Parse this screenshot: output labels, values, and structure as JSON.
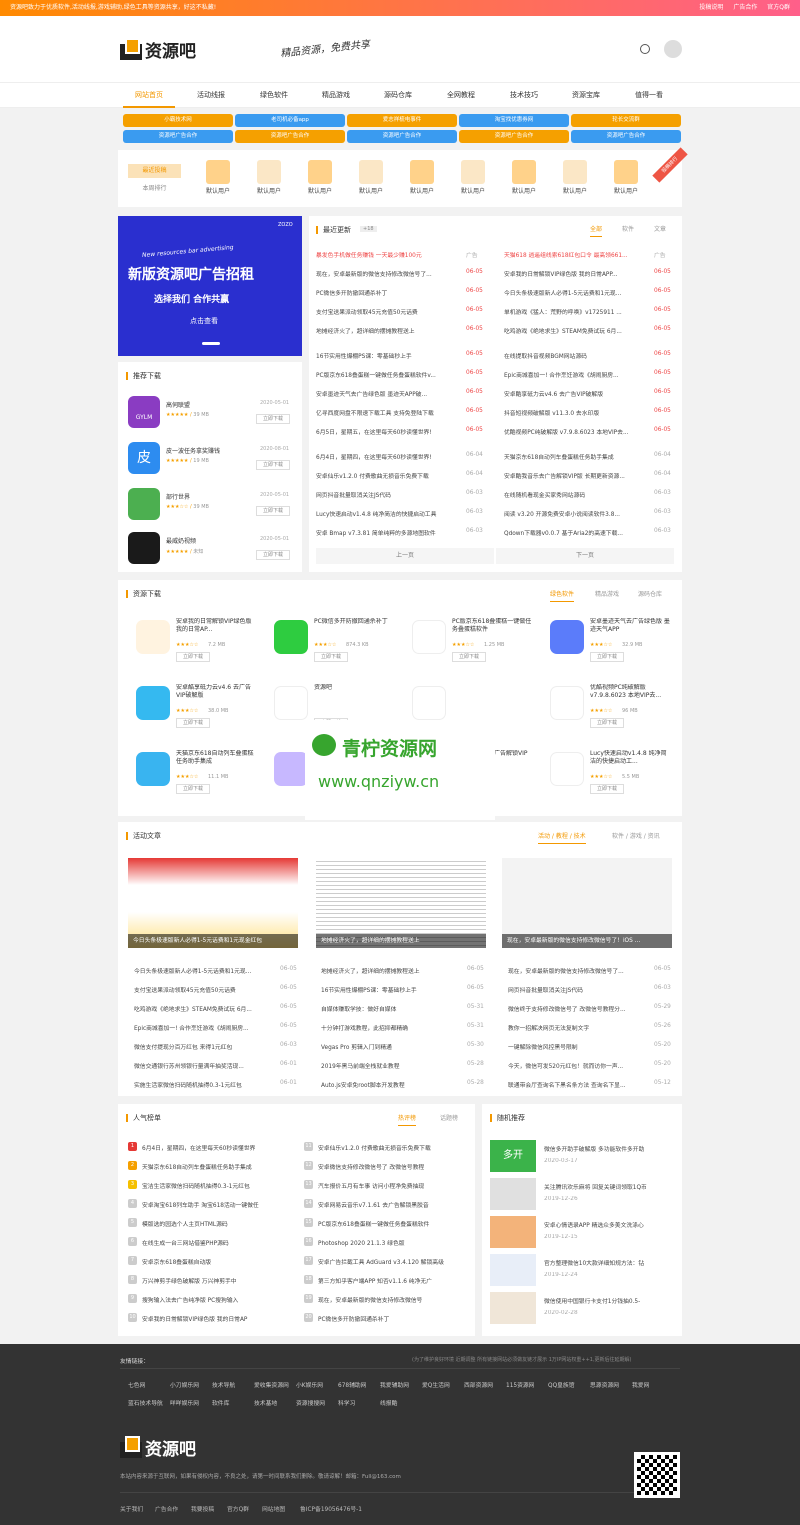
{
  "topbar": {
    "left": "资源吧致力于优质软件,活动线报,游戏辅助,绿色工具等资源共享，好这不私藏!",
    "links": [
      "投稿说明",
      "广告合作",
      "官方Q群"
    ]
  },
  "header": {
    "logo": "资源吧",
    "slogan": "精品资源，免费共享"
  },
  "nav": [
    "网站首页",
    "活动线报",
    "绿色软件",
    "精品游戏",
    "源码仓库",
    "全网教程",
    "技术技巧",
    "资源宝库",
    "值得一看"
  ],
  "tags": [
    "小霸技术网",
    "老司机必备app",
    "爱志祥梳电事件",
    "淘宝找优惠券网",
    "轮长交流群",
    "资源吧广告合作",
    "资源吧广告合作",
    "资源吧广告合作",
    "资源吧广告合作",
    "资源吧广告合作"
  ],
  "users": {
    "tabs": [
      "最近投稿",
      "本周排行"
    ],
    "name": "默认用户",
    "badge": "投稿排行"
  },
  "banner": {
    "eyebrow": "New resources bar advertising",
    "title": "新版资源吧广告招租",
    "subtitle": "选择我们 合作共赢",
    "button": "点击查看",
    "corner": "ZOZO"
  },
  "recommend": {
    "title": "推荐下载",
    "items": [
      {
        "name": "高伺联盟",
        "date": "2020-05-01",
        "size": "39 MB",
        "btn": "立即下载",
        "label": "GYLM"
      },
      {
        "name": "皮一波任务拿奖赚钱",
        "date": "2020-08-01",
        "size": "19 MB",
        "btn": "立即下载",
        "label": "皮"
      },
      {
        "name": "部行世界",
        "date": "2020-05-01",
        "size": "39 MB",
        "btn": "立即下载",
        "label": ""
      },
      {
        "name": "最威奶视频",
        "date": "2020-05-01",
        "size": "未知",
        "btn": "立即下载",
        "label": ""
      }
    ]
  },
  "latest": {
    "title": "最近更新",
    "count": "+18",
    "tabs": [
      "全部",
      "软件",
      "文章"
    ],
    "ad_label": "广告",
    "left": [
      {
        "t": "暴发色手机做任务赚钱 一天最少赚100元",
        "d": "广告",
        "red": true
      },
      {
        "t": "现在，安卓最新版的微信支持修改微信号了...",
        "d": "06-05"
      },
      {
        "t": "PC微信多开防撤回通杀补丁",
        "d": "06-05"
      },
      {
        "t": "支付宝送果派动领取45元充值50元话费",
        "d": "06-05"
      },
      {
        "t": "地摊经济火了，超详细的摆摊教程送上",
        "d": "06-05"
      },
      {
        "t": "16节实用性爆棚PS课：零基础秒上手",
        "d": "06-05"
      },
      {
        "t": "PC版京东618叠蛋糕一键做任务叠蛋糕软件v...",
        "d": "06-05"
      },
      {
        "t": "安卓墨迹天气去广告绿色版 墨迹天APP破...",
        "d": "06-05"
      },
      {
        "t": "亿寻西度网盘不限速下载工具 支持免登陆下载",
        "d": "06-05"
      },
      {
        "t": "6月5日，星期五，在这里每天60秒读懂世界!",
        "d": "06-05"
      },
      {
        "t": "6月4日，星期四，在这里每天60秒读懂世界!",
        "d": "06-04"
      },
      {
        "t": "安卓仙乐v1.2.0 付费歌曲无损音乐免费下载",
        "d": "06-04"
      },
      {
        "t": "网页抖音批量取消关注JS代码",
        "d": "06-03"
      },
      {
        "t": "Lucy快速启动v1.4.8 纯净简洁的快捷启动工具",
        "d": "06-03"
      },
      {
        "t": "安卓 Bmap v7.3.81 简单纯粹的多源地图软件",
        "d": "06-03"
      }
    ],
    "right": [
      {
        "t": "天猫618 逍遥组线索618红包口令 最高领661...",
        "d": "广告",
        "red": true
      },
      {
        "t": "安卓我的日常解锁VIP绿色版 我的日常APP...",
        "d": "06-05"
      },
      {
        "t": "今日头条极速版新人必得1-5元话费和1元现...",
        "d": "06-05"
      },
      {
        "t": "单机游戏《猛人：荒野的呼唤》v1725911 ...",
        "d": "06-05"
      },
      {
        "t": "吃鸡游戏《绝地求生》STEAM免费试玩 6月...",
        "d": "06-05"
      },
      {
        "t": "在线提取抖音视频BGM网站源码",
        "d": "06-05"
      },
      {
        "t": "Epic商城喜加一! 合作烹饪游戏《胡闹厨房...",
        "d": "06-05"
      },
      {
        "t": "安卓酷享砥力云v4.6 去广告VIP破解版",
        "d": "06-05"
      },
      {
        "t": "抖音短视频破解版 v11.3.0 去水印版",
        "d": "06-05"
      },
      {
        "t": "优酷视频PC纯破解版 v7.9.8.6023 本地VIP去...",
        "d": "06-05"
      },
      {
        "t": "天猫京东618自动列车叠蛋糕任务助手集成",
        "d": "06-04"
      },
      {
        "t": "安卓酷我音乐去广告解锁VIP版 长期更新资源...",
        "d": "06-04"
      },
      {
        "t": "在线随机看现金买家秀网站源码",
        "d": "06-03"
      },
      {
        "t": "阅读 v3.20 开源免费安卓小说阅读软件3.8...",
        "d": "06-03"
      },
      {
        "t": "Qdown下载器v0.0.7 基于Aria2的高速下载...",
        "d": "06-03"
      }
    ],
    "prev": "上一页",
    "next": "下一页"
  },
  "resources": {
    "title": "资源下载",
    "tabs": [
      "绿色软件",
      "精品游戏",
      "源码仓库"
    ],
    "items": [
      {
        "name": "安卓我的日常解锁VIP绿色版 我的日常AP...",
        "size": "7.2 MB",
        "btn": "立即下载"
      },
      {
        "name": "PC微信多开防撤回通杀补丁",
        "size": "874.3 KB",
        "btn": "立即下载"
      },
      {
        "name": "PC版京东618叠蛋糕一键做任务叠蛋糕软件",
        "size": "1.25 MB",
        "btn": "立即下载"
      },
      {
        "name": "安卓墨迹天气去广告绿色版 墨迹天气APP",
        "size": "32.9 MB",
        "btn": "立即下载"
      },
      {
        "name": "安卓酷享砥力云v4.6 去广告VIP破解版",
        "size": "38.0 MB",
        "btn": "立即下载"
      },
      {
        "name": "资源吧",
        "size": "",
        "btn": "立即下载"
      },
      {
        "name": "",
        "size": "",
        "btn": ""
      },
      {
        "name": "优酷视频PC纯破解版 v7.9.8.6023 本地VIP去...",
        "size": "96 MB",
        "btn": "立即下载"
      },
      {
        "name": "天猫京东618自动列车叠蛋糕任务助手集成",
        "size": "11.1 MB",
        "btn": "立即下载"
      },
      {
        "name": "",
        "size": "",
        "btn": ""
      },
      {
        "name": "安卓酷我音乐去广告解锁VIP版",
        "size": "",
        "btn": ""
      },
      {
        "name": "Lucy快速启动v1.4.8 纯净简洁的快捷启动工...",
        "size": "5.5 MB",
        "btn": "立即下载"
      }
    ],
    "icon_labels": {
      "pos5": "酷",
      "pos9": "喜购",
      "youku": "YOUKU"
    }
  },
  "watermark": {
    "cn": "青柠资源网",
    "url": "www.qnziyw.cn"
  },
  "activity": {
    "title": "活动文章",
    "tabs": [
      "活动 / 教程 / 技术",
      "软件 / 游戏 / 资讯"
    ],
    "captions": [
      "今日头条极速版新人必得1-5元话费和1元现金红包",
      "地摊经济火了，超详细的摆摊教程送上",
      "现在，安卓最新版的微信支持修改微信号了！iOS ..."
    ],
    "col1": [
      {
        "t": "今日头条极速版新人必得1-5元话费和1元现...",
        "d": "06-05"
      },
      {
        "t": "支付宝送果派动领取45元充值50元话费",
        "d": "06-05"
      },
      {
        "t": "吃鸡游戏《绝地求生》STEAM免费试玩 6月...",
        "d": "06-05"
      },
      {
        "t": "Epic商城喜加一! 合作烹饪游戏《胡闹厨房...",
        "d": "06-05"
      },
      {
        "t": "微信支付提现分百万红包 来得1元红包",
        "d": "06-03"
      },
      {
        "t": "微信交通银行苏州领银行量满年抽奖活现...",
        "d": "06-01"
      },
      {
        "t": "实施生活家微信扫码随机抽得0.3-1元红包",
        "d": "06-01"
      }
    ],
    "col2": [
      {
        "t": "地摊经济火了，超详细的摆摊教程送上",
        "d": "06-05"
      },
      {
        "t": "16节实用性爆棚PS课：零基础秒上手",
        "d": "06-05"
      },
      {
        "t": "自媒体赚取学技：做好自媒体",
        "d": "05-31"
      },
      {
        "t": "十分钟打游戏教程，此招抑都精确",
        "d": "05-31"
      },
      {
        "t": "Vegas Pro 剪辑入门到精通",
        "d": "05-30"
      },
      {
        "t": "2019年黑马前端全栈就业教程",
        "d": "05-28"
      },
      {
        "t": "Auto.js安卓免root脚本开发教程",
        "d": "05-28"
      }
    ],
    "col3": [
      {
        "t": "现在，安卓最新版的微信支持修改微信号了...",
        "d": "06-05"
      },
      {
        "t": "网页抖音批量取消关注JS代码",
        "d": "06-03"
      },
      {
        "t": "微信终于支持修改微信号了 改微信号教程分...",
        "d": "05-29"
      },
      {
        "t": "教你一招解决网页无法复制文字",
        "d": "05-26"
      },
      {
        "t": "一键解除微信风控黑号限制",
        "d": "05-20"
      },
      {
        "t": "今天，微信可发520元红包！就而访你一声...",
        "d": "05-20"
      },
      {
        "t": "联通带会厅查询名下黑名条方法 查询名下显...",
        "d": "05-12"
      }
    ]
  },
  "popular": {
    "title": "人气榜单",
    "tabs": [
      "热评榜",
      "话题榜"
    ],
    "left": [
      "6月4日，星期四，在这里每天60秒读懂世界",
      "天猫京东618自动列车叠蛋糕任务助手集成",
      "宝洁生活家微信扫码随机抽得0.3-1元红包",
      "安卓淘宝618列车助手 淘宝618活动一键做任",
      "模版选的园选个人主页HTML源码",
      "在线生成一台三网站借鉴PHP源码",
      "安卓京东618叠蛋糕自动版",
      "万兴神剪手绿色破解版 万兴神剪手中",
      "搜狗输入法去广告纯净版 PC搜狗输入",
      "安卓我的日常解锁VIP绿色版 我的日常AP"
    ],
    "right": [
      "安卓仙乐v1.2.0 付费歌曲无损音乐免费下载",
      "安卓微信支持修改微信号了 改微信号教程",
      "汽车报价五月有车事 访问小程净免费抽现",
      "安卓网易云音乐v7.1.61 去广告解锁黑胶音",
      "PC版京东618叠蛋糕一键做任务叠蛋糕软件",
      "Photoshop 2020 21.1.3 绿色版",
      "安卓广告拦截工具 AdGuard v3.4.120 解锁高级",
      "第三方知乎客户端APP 知否v1.1.6 纯净无广",
      "现在，安卓最新版的微信支持修改微信号",
      "PC微信多开防撤回通杀补丁"
    ]
  },
  "random": {
    "title": "随机推荐",
    "items": [
      {
        "t": "微信多开助手破解版 多功能软件多开助",
        "d": "2020-03-17",
        "icon": "多开"
      },
      {
        "t": "关注腾讯欢乐麻将 回复关键词领取1Q币",
        "d": "2019-12-26",
        "icon": ""
      },
      {
        "t": "安卓心情语录APP 精选众多美文洗涤心",
        "d": "2019-12-15",
        "icon": ""
      },
      {
        "t": "官方整理微信10大款详细知规方法：钻",
        "d": "2019-12-24",
        "icon": ""
      },
      {
        "t": "微信使用中国银行卡支付1分钱抽0.5-",
        "d": "2020-02-28",
        "icon": ""
      }
    ]
  },
  "footer": {
    "friend_title": "友情链接：",
    "notice": "(为了维护良好环境 近期调整 所有链接网站必须做友链才展示 1万IP网站权重++1,更新后往延期解)",
    "links": [
      "七色网",
      "小刀娱乐网",
      "技术导航",
      "爱收集资源网",
      "小K娱乐网",
      "678辅助网",
      "我爱辅助网",
      "爱Q生活网",
      "西部资源网",
      "115资源网",
      "QQ皇族馆",
      "思源资源网",
      "我爱网",
      "蓝石技术导航",
      "咩咩娱乐网",
      "软件库",
      "技术基地",
      "资源搜搜网",
      "科学习",
      "线报酷"
    ],
    "logo": "资源吧",
    "disclaimer": "本站内容来源于互联网，如果有侵权内容，不良之处，请第一时间联系我们删除。敬请谅解！邮箱：Full@163.com",
    "menu": [
      "关于我们",
      "广告合作",
      "我要投稿",
      "官方Q群",
      "网站地图",
      "鲁ICP备19056476号-1"
    ]
  },
  "colors": {
    "accent": "#f39800",
    "topbar_from": "#ff8a00",
    "topbar_to": "#ff5f8a",
    "tag_orange": "#f5a000",
    "tag_blue": "#3a9bf0",
    "banner_bg": "#2a2fcf"
  }
}
